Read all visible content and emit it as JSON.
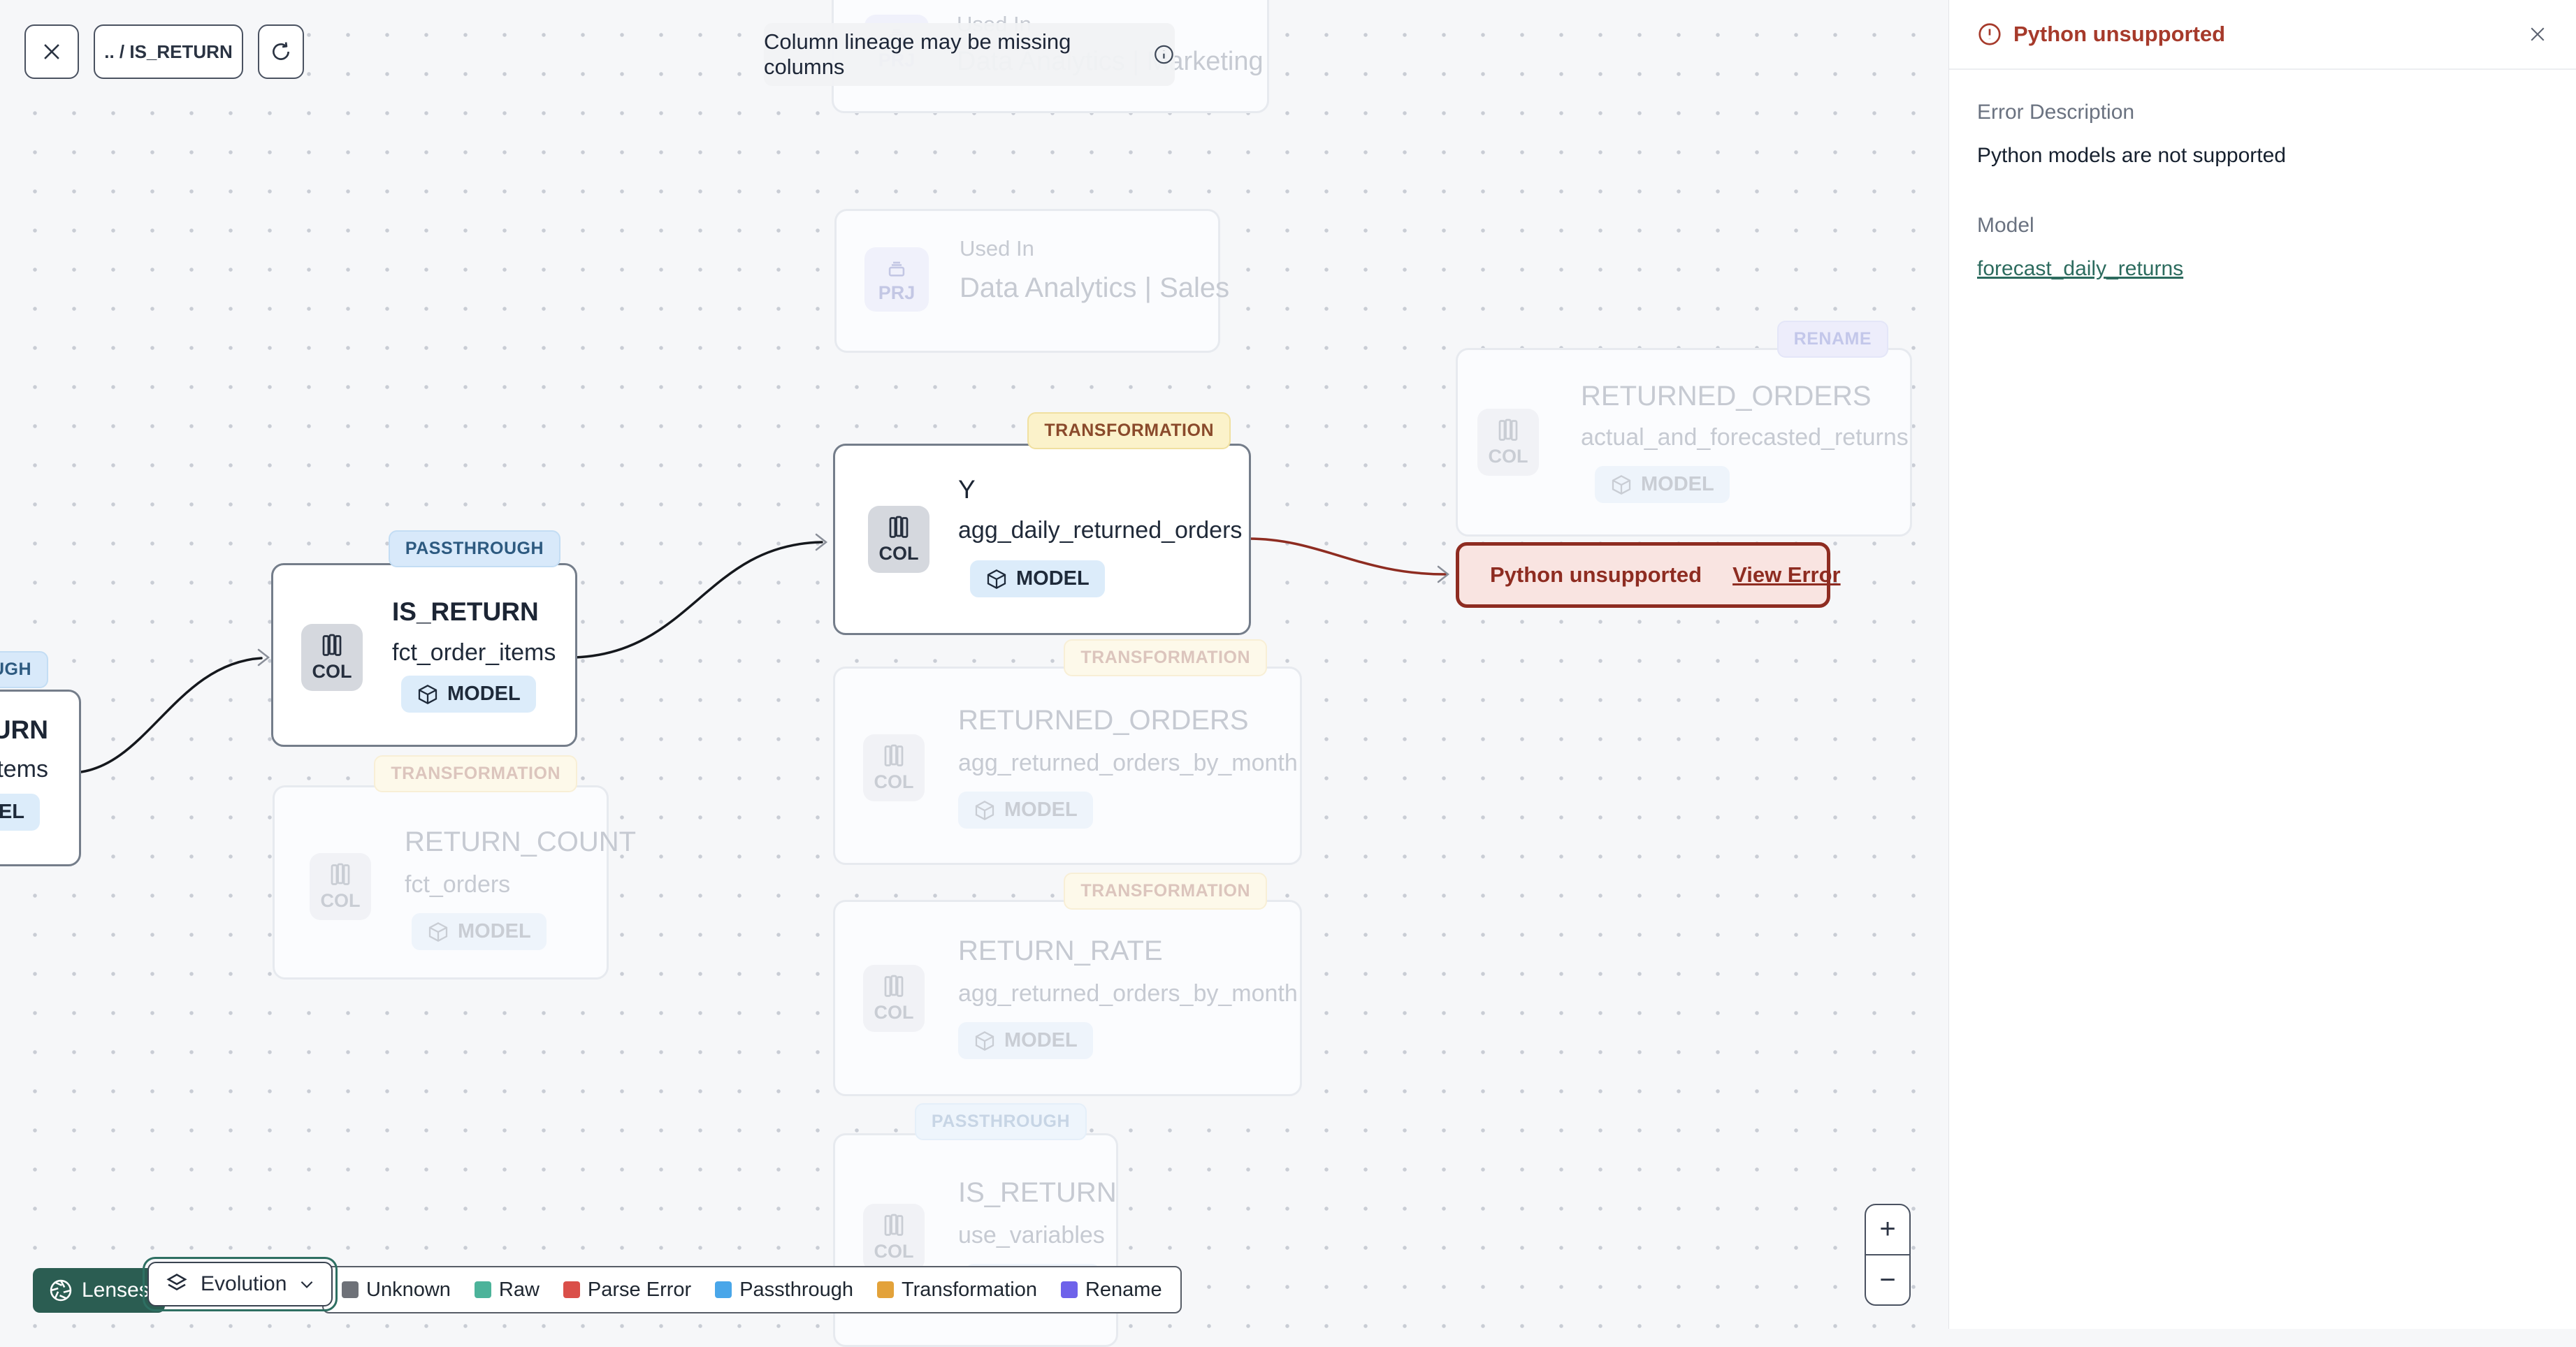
{
  "toolbar": {
    "breadcrumb": ".. / IS_RETURN"
  },
  "banner": {
    "text": "Column lineage may be missing columns"
  },
  "labels": {
    "col": "COL",
    "prj": "PRJ",
    "model": "MODEL"
  },
  "tags": {
    "passthrough": "PASSTHROUGH",
    "transformation": "TRANSFORMATION",
    "rename": "RENAME"
  },
  "nodes": {
    "top_marketing": {
      "title": "Used In",
      "subtitle": "Data Analytics | Marketing"
    },
    "used_in_sales": {
      "title": "Used In",
      "subtitle": "Data Analytics | Sales"
    },
    "central": {
      "title": "Y",
      "subtitle": "agg_daily_returned_orders"
    },
    "is_return": {
      "title": "IS_RETURN",
      "subtitle": "fct_order_items"
    },
    "left_cut": {
      "title": "IS_RETURN",
      "subtitle": "stg_order_items"
    },
    "returned_orders_rename": {
      "title": "RETURNED_ORDERS",
      "subtitle": "actual_and_forecasted_returns"
    },
    "returned_orders_transform": {
      "title": "RETURNED_ORDERS",
      "subtitle": "agg_returned_orders_by_month"
    },
    "return_count": {
      "title": "RETURN_COUNT",
      "subtitle": "fct_orders"
    },
    "return_rate": {
      "title": "RETURN_RATE",
      "subtitle": "agg_returned_orders_by_month"
    },
    "is_return_bottom": {
      "title": "IS_RETURN",
      "subtitle": "use_variables"
    }
  },
  "error_chip": {
    "label": "Python unsupported",
    "action": "View Error"
  },
  "panel": {
    "title": "Python unsupported",
    "error_description_label": "Error Description",
    "error_description": "Python models are not supported",
    "model_label": "Model",
    "model_link": "forecast_daily_returns"
  },
  "footer": {
    "lenses": "Lenses",
    "lens_selected": "Evolution",
    "legend": [
      {
        "label": "Unknown",
        "color": "#6e7178"
      },
      {
        "label": "Raw",
        "color": "#4cb39a"
      },
      {
        "label": "Parse Error",
        "color": "#da4f49"
      },
      {
        "label": "Passthrough",
        "color": "#49a6e9"
      },
      {
        "label": "Transformation",
        "color": "#e3a23a"
      },
      {
        "label": "Rename",
        "color": "#6e62ea"
      }
    ]
  },
  "zoom": {
    "zoom_in": "+",
    "zoom_out": "−"
  },
  "colors": {
    "accent_teal": "#2b5d52",
    "error_red": "#8e2c21",
    "edge_black": "#15181d",
    "tag_transformation_bg": "#fbf2ca",
    "tag_passthrough_bg": "#d8e9fa"
  }
}
